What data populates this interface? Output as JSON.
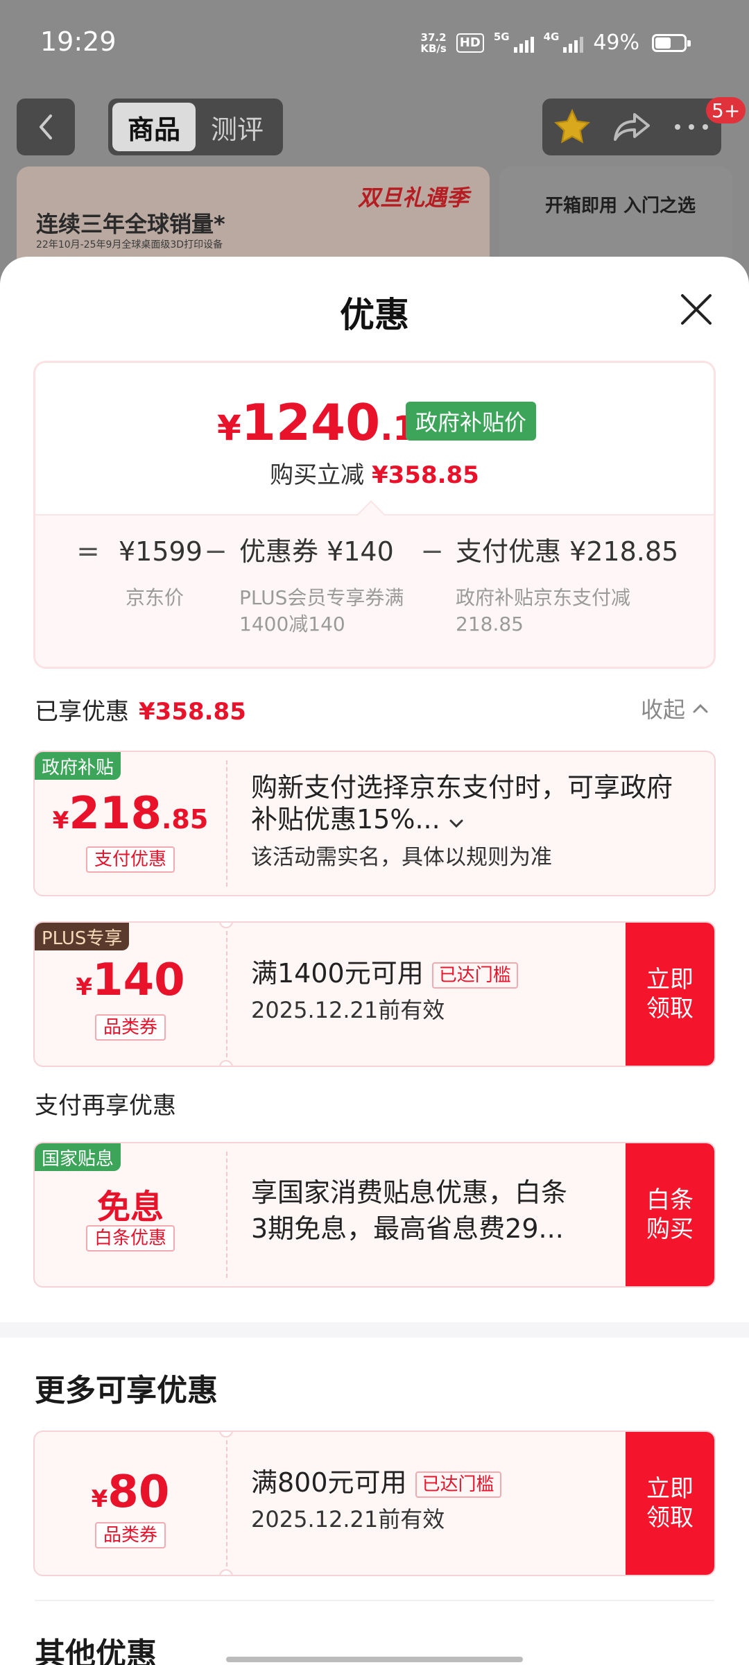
{
  "status_bar": {
    "time": "19:29",
    "net_speed_value": "37.2",
    "net_speed_unit": "KB/s",
    "hd": "HD",
    "sim1_label": "5G",
    "sim2_label": "4G",
    "battery": "49%"
  },
  "nav": {
    "tabs": [
      "商品",
      "测评"
    ],
    "cart_badge": "5+"
  },
  "background_banner": {
    "promo": "双旦礼遇季",
    "slogan": "连续三年全球销量*",
    "note": "22年10月-25年9月全球桌面级3D打印设备",
    "right_text": "开箱即用 入门之选"
  },
  "sheet": {
    "title": "优惠",
    "price": {
      "currency": "¥",
      "integer": "1240",
      "decimal": ".15",
      "tag": "政府补贴价",
      "save_label": "购买立减",
      "save_amount": "¥358.85"
    },
    "formula": {
      "eq": "=",
      "minus": "−",
      "items": [
        {
          "value": "¥1599",
          "desc": "京东价"
        },
        {
          "value": "优惠券 ¥140",
          "desc": "PLUS会员专享券满1400减140"
        },
        {
          "value": "支付优惠 ¥218.85",
          "desc": "政府补贴京东支付减218.85"
        }
      ]
    },
    "enjoyed": {
      "label": "已享优惠",
      "amount": "¥358.85",
      "collapse": "收起"
    },
    "coupons": [
      {
        "corner": "政府补贴",
        "currency": "¥",
        "integer": "218",
        "decimal": ".85",
        "type": "支付优惠",
        "line1": "购新支付选择京东支付时，可享政府补贴优惠15%...",
        "line2": "该活动需实名，具体以规则为准"
      },
      {
        "corner": "PLUS专享",
        "currency": "¥",
        "integer": "140",
        "type": "品类券",
        "line1": "满1400元可用",
        "reached": "已达门槛",
        "line2": "2025.12.21前有效",
        "button": "立即领取"
      }
    ],
    "pay_again": {
      "label": "支付再享优惠",
      "corner": "国家贴息",
      "amount_text": "免息",
      "type": "白条优惠",
      "line1": "享国家消费贴息优惠，白条",
      "line2": "3期免息，最高省息费29...",
      "button": "白条购买"
    },
    "more": {
      "title": "更多可享优惠",
      "currency": "¥",
      "integer": "80",
      "type": "品类券",
      "line1": "满800元可用",
      "reached": "已达门槛",
      "line2": "2025.12.21前有效",
      "button": "立即领取"
    },
    "other_title": "其他优惠"
  }
}
